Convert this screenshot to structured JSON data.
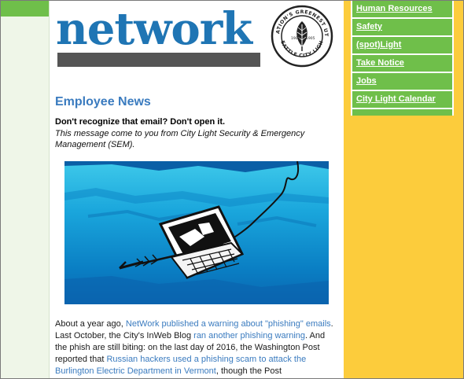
{
  "masthead": {
    "wordmark": "network",
    "seal_text_top": "THE NATION'S GREENEST UTILITY",
    "seal_text_bottom": "SEATTLE CITY LIGHT",
    "seal_year_left": "1905",
    "seal_year_right": "1905"
  },
  "nav": {
    "items": [
      {
        "label": "Human Resources"
      },
      {
        "label": "Safety"
      },
      {
        "label": "(spot)Light"
      },
      {
        "label": "Take Notice"
      },
      {
        "label": "Jobs"
      },
      {
        "label": "City Light Calendar"
      }
    ]
  },
  "article": {
    "section_title": "Employee News",
    "headline": "Don't recognize that email? Don't open it.",
    "subhead": "This message come to you from City Light Security & Emergency Management (SEM).",
    "p1_t1": "About a year ago, ",
    "p1_l1": "NetWork published a warning about \"phishing\" emails",
    "p1_t2": ". Last October, the City's InWeb Blog ",
    "p1_l2": "ran another phishing warning",
    "p1_t3": ". And the phish are still biting: on the last day of 2016, the Washington Post reported that ",
    "p1_l3": "Russian hackers used a phishing scam to attack the Burlington Electric Department in Vermont",
    "p1_t4": ", though the Post"
  },
  "colors": {
    "brand_blue": "#1f75b4",
    "nav_green": "#6fbf4a",
    "panel_yellow": "#fccc3c",
    "link_blue": "#3a7bbf"
  }
}
